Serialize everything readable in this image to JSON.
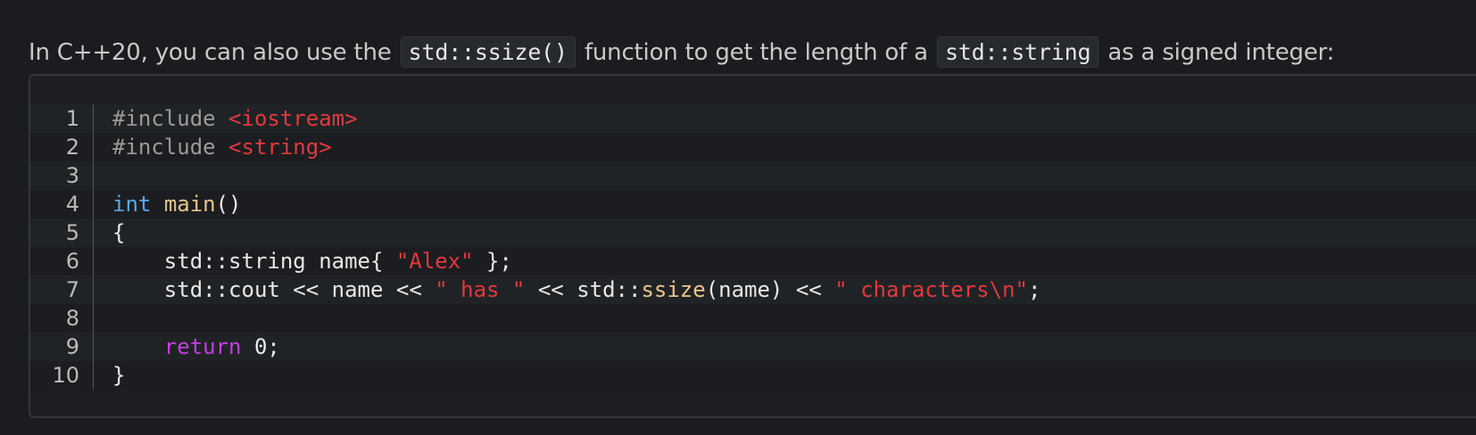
{
  "intro": {
    "text_1": "In C++20, you can also use the ",
    "code_1": "std::ssize()",
    "text_2": " function to get the length of a ",
    "code_2": "std::string",
    "text_3": " as a signed integer:"
  },
  "code": {
    "lines": [
      {
        "number": "1",
        "tokens": [
          {
            "t": "pre",
            "v": "#include "
          },
          {
            "t": "inc",
            "v": "<iostream>"
          }
        ]
      },
      {
        "number": "2",
        "tokens": [
          {
            "t": "pre",
            "v": "#include "
          },
          {
            "t": "inc",
            "v": "<string>"
          }
        ]
      },
      {
        "number": "3",
        "tokens": []
      },
      {
        "number": "4",
        "tokens": [
          {
            "t": "kw",
            "v": "int"
          },
          {
            "t": "plain",
            "v": " "
          },
          {
            "t": "fn",
            "v": "main"
          },
          {
            "t": "plain",
            "v": "()"
          }
        ]
      },
      {
        "number": "5",
        "tokens": [
          {
            "t": "plain",
            "v": "{"
          }
        ]
      },
      {
        "number": "6",
        "tokens": [
          {
            "t": "plain",
            "v": "    std::string name{ "
          },
          {
            "t": "str",
            "v": "\"Alex\""
          },
          {
            "t": "plain",
            "v": " };"
          }
        ]
      },
      {
        "number": "7",
        "tokens": [
          {
            "t": "plain",
            "v": "    std::cout << name << "
          },
          {
            "t": "str",
            "v": "\" has \""
          },
          {
            "t": "plain",
            "v": " << std::"
          },
          {
            "t": "fn",
            "v": "ssize"
          },
          {
            "t": "plain",
            "v": "(name) << "
          },
          {
            "t": "str",
            "v": "\" characters\\n\""
          },
          {
            "t": "plain",
            "v": ";"
          }
        ]
      },
      {
        "number": "8",
        "tokens": []
      },
      {
        "number": "9",
        "tokens": [
          {
            "t": "plain",
            "v": "    "
          },
          {
            "t": "ret",
            "v": "return"
          },
          {
            "t": "plain",
            "v": " "
          },
          {
            "t": "num",
            "v": "0"
          },
          {
            "t": "plain",
            "v": ";"
          }
        ]
      },
      {
        "number": "10",
        "tokens": [
          {
            "t": "plain",
            "v": "}"
          }
        ]
      }
    ]
  }
}
